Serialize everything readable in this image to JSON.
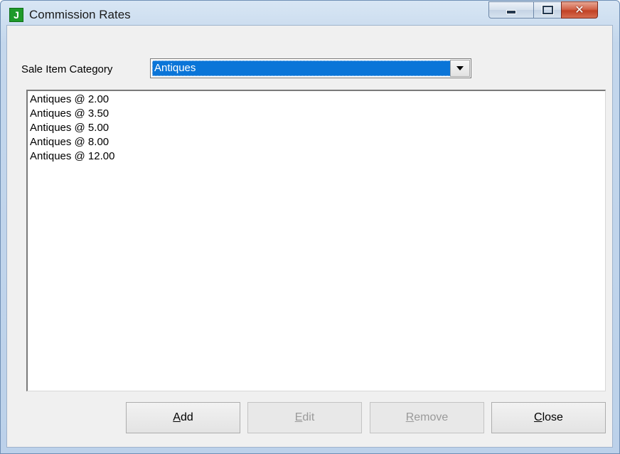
{
  "window": {
    "title": "Commission Rates",
    "icon_letter": "J"
  },
  "form": {
    "category_label": "Sale Item Category",
    "category_value": "Antiques"
  },
  "rates_list": [
    "Antiques @ 2.00",
    "Antiques @ 3.50",
    "Antiques @ 5.00",
    "Antiques @ 8.00",
    "Antiques @ 12.00"
  ],
  "buttons": {
    "add": {
      "first": "A",
      "rest": "dd"
    },
    "edit": {
      "first": "E",
      "rest": "dit",
      "enabled": false
    },
    "remove": {
      "first": "R",
      "rest": "emove",
      "enabled": false
    },
    "close": {
      "first": "C",
      "rest": "lose"
    }
  },
  "colors": {
    "selection": "#0a75d8",
    "close_button": "#c14225",
    "app_icon": "#1f9a2a"
  }
}
